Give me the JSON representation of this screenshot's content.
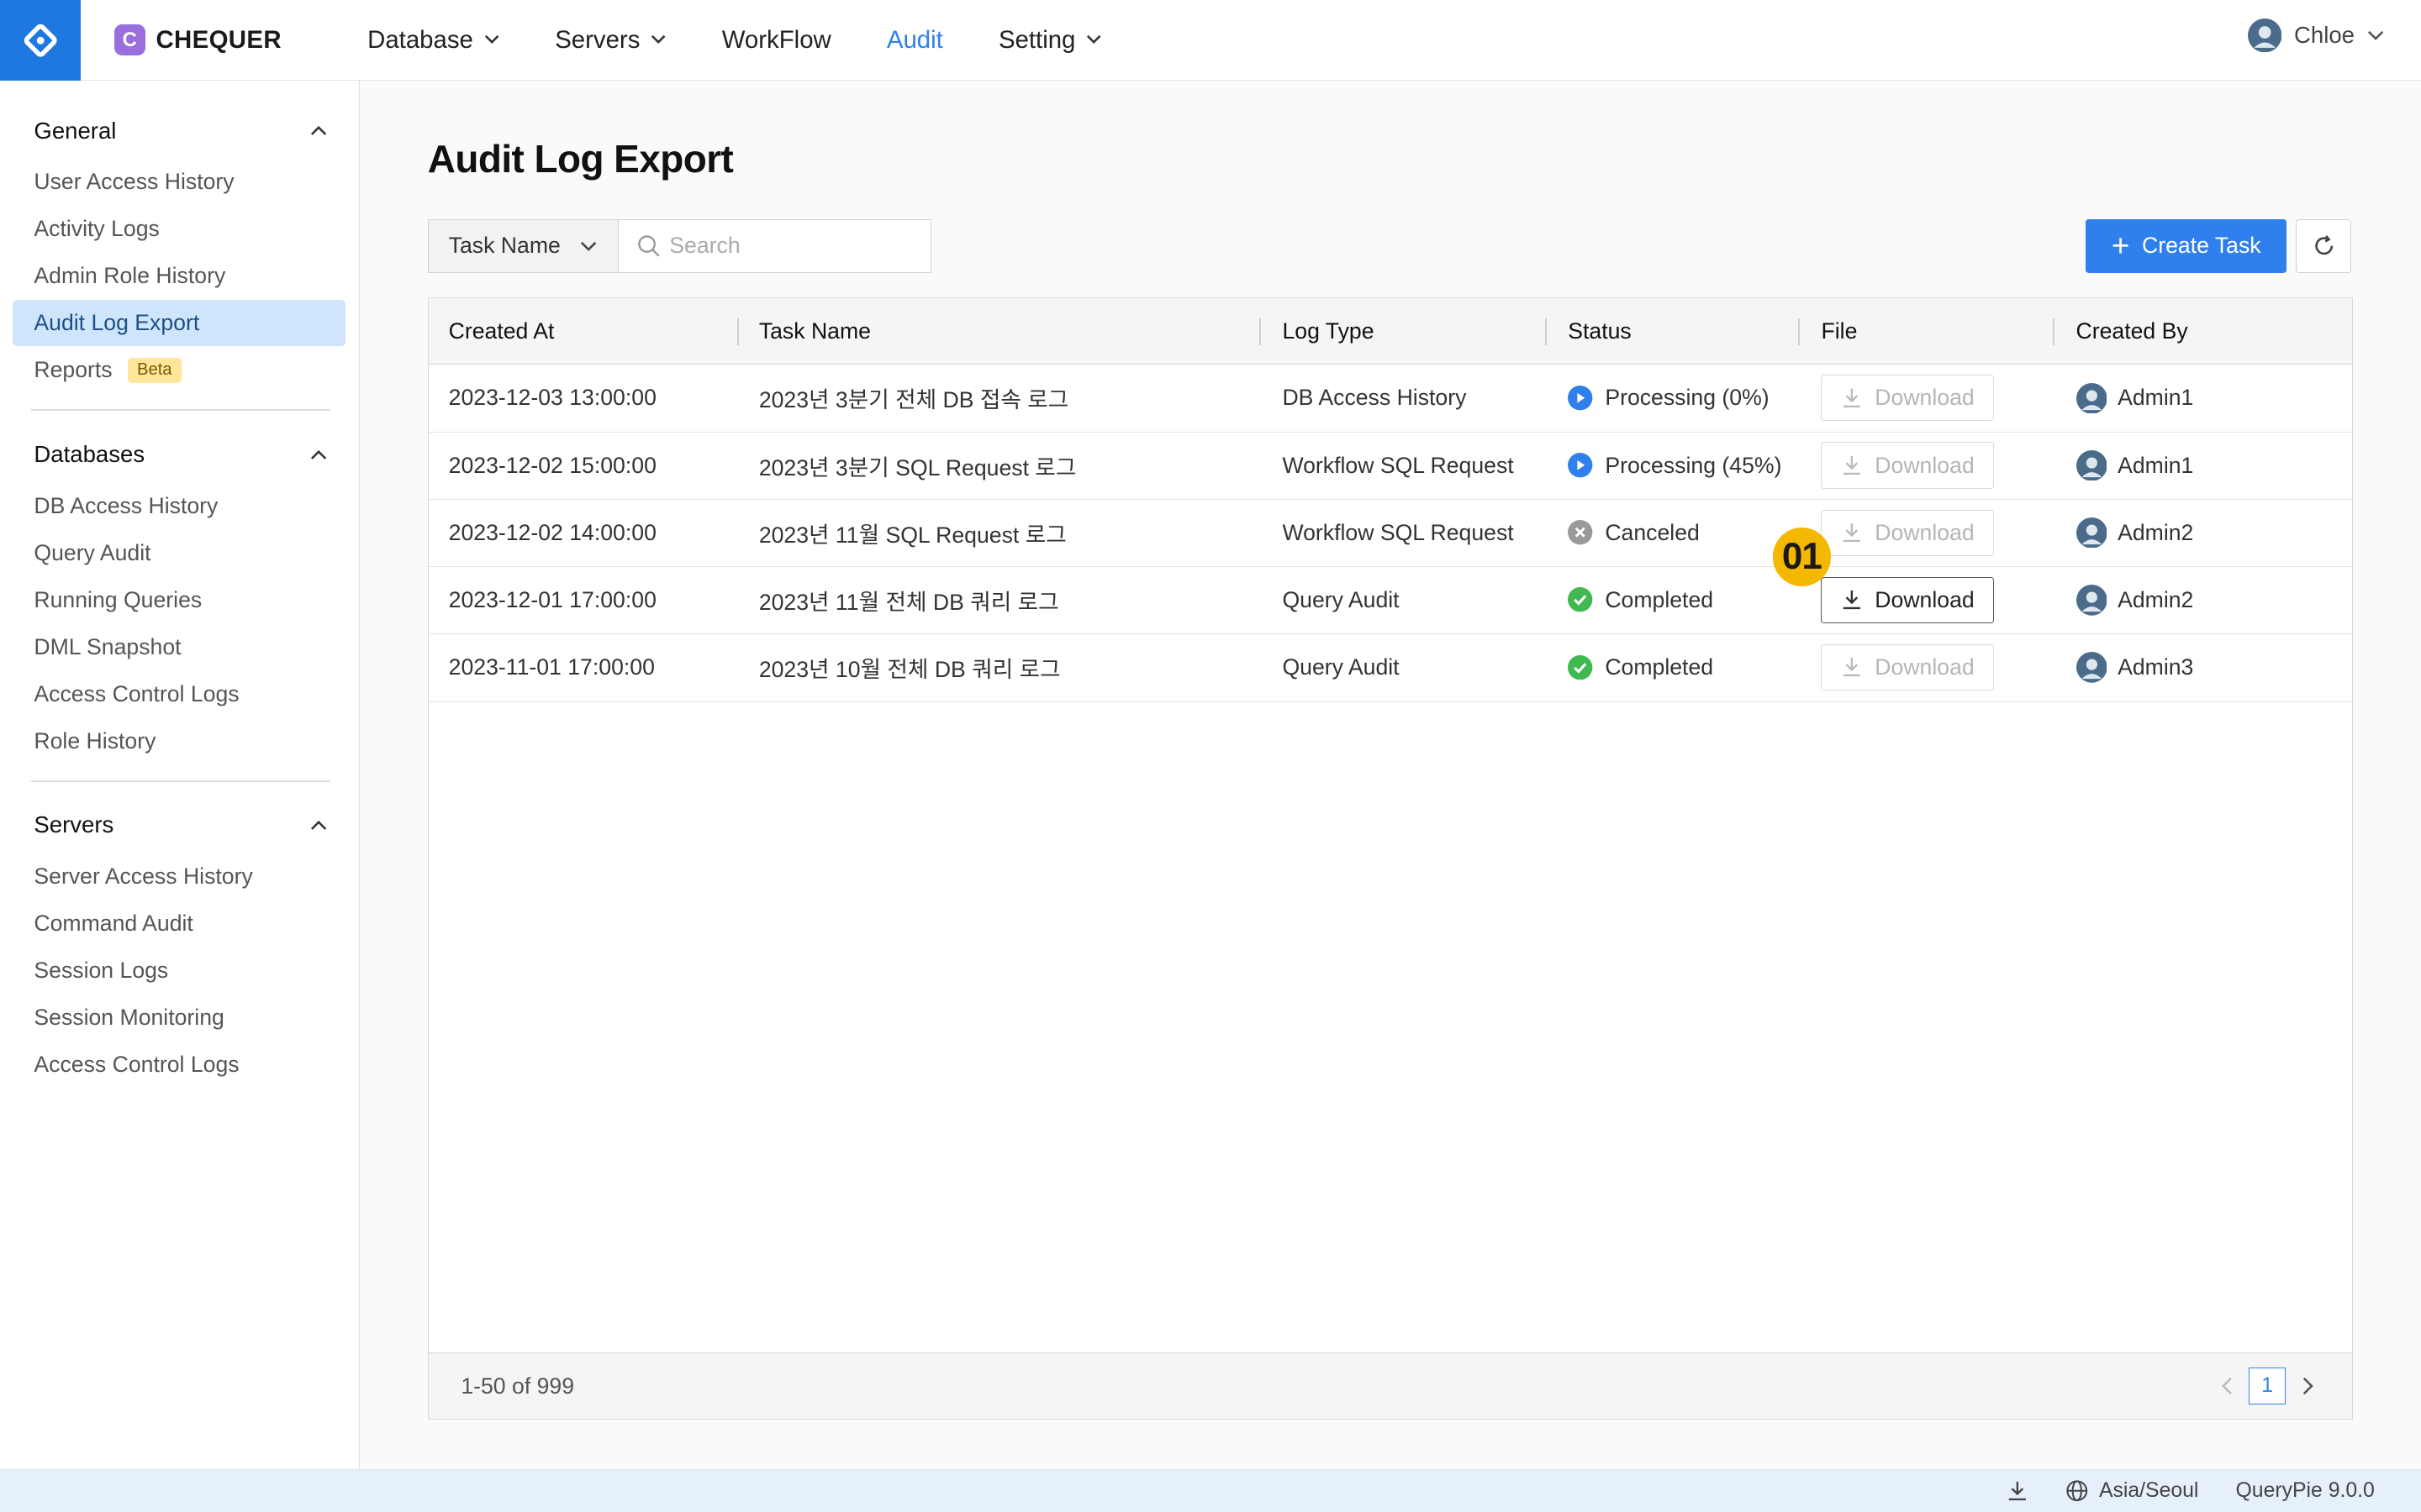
{
  "brand": {
    "badge": "C",
    "name": "CHEQUER"
  },
  "nav": [
    {
      "label": "Database",
      "dropdown": true,
      "active": false
    },
    {
      "label": "Servers",
      "dropdown": true,
      "active": false
    },
    {
      "label": "WorkFlow",
      "dropdown": false,
      "active": false
    },
    {
      "label": "Audit",
      "dropdown": false,
      "active": true
    },
    {
      "label": "Setting",
      "dropdown": true,
      "active": false
    }
  ],
  "user": {
    "name": "Chloe"
  },
  "sidebar": {
    "general": {
      "title": "General",
      "items": [
        "User Access History",
        "Activity Logs",
        "Admin Role History",
        "Audit Log Export",
        "Reports"
      ],
      "badge": "Beta"
    },
    "databases": {
      "title": "Databases",
      "items": [
        "DB Access History",
        "Query Audit",
        "Running Queries",
        "DML Snapshot",
        "Access Control Logs",
        "Role History"
      ]
    },
    "servers": {
      "title": "Servers",
      "items": [
        "Server Access History",
        "Command Audit",
        "Session Logs",
        "Session Monitoring",
        "Access Control Logs"
      ]
    }
  },
  "page": {
    "title": "Audit Log Export",
    "filter_label": "Task Name",
    "search_placeholder": "Search",
    "create_label": "Create Task"
  },
  "table": {
    "columns": [
      "Created At",
      "Task Name",
      "Log Type",
      "Status",
      "File",
      "Created By"
    ],
    "download_label": "Download",
    "rows": [
      {
        "created_at": "2023-12-03 13:00:00",
        "task_name": "2023년 3분기 전체 DB 접속 로그",
        "log_type": "DB Access History",
        "status": "Processing (0%)",
        "status_kind": "processing",
        "download_enabled": false,
        "created_by": "Admin1"
      },
      {
        "created_at": "2023-12-02 15:00:00",
        "task_name": "2023년 3분기 SQL Request 로그",
        "log_type": "Workflow SQL Request",
        "status": "Processing (45%)",
        "status_kind": "processing",
        "download_enabled": false,
        "created_by": "Admin1"
      },
      {
        "created_at": "2023-12-02 14:00:00",
        "task_name": "2023년 11월 SQL Request 로그",
        "log_type": "Workflow SQL Request",
        "status": "Canceled",
        "status_kind": "canceled",
        "download_enabled": false,
        "created_by": "Admin2"
      },
      {
        "created_at": "2023-12-01 17:00:00",
        "task_name": "2023년 11월 전체 DB 쿼리 로그",
        "log_type": "Query Audit",
        "status": "Completed",
        "status_kind": "completed",
        "download_enabled": true,
        "created_by": "Admin2"
      },
      {
        "created_at": "2023-11-01 17:00:00",
        "task_name": "2023년 10월 전체 DB 쿼리 로그",
        "log_type": "Query Audit",
        "status": "Completed",
        "status_kind": "completed",
        "download_enabled": false,
        "created_by": "Admin3"
      }
    ],
    "range_text": "1-50 of 999",
    "current_page": "1"
  },
  "callout": "01",
  "statusbar": {
    "timezone": "Asia/Seoul",
    "version": "QueryPie 9.0.0"
  },
  "colors": {
    "primary": "#2f80ed",
    "processing": "#2f80ed",
    "completed": "#3fb950",
    "canceled": "#9a9a9a",
    "callout": "#f5b800"
  }
}
